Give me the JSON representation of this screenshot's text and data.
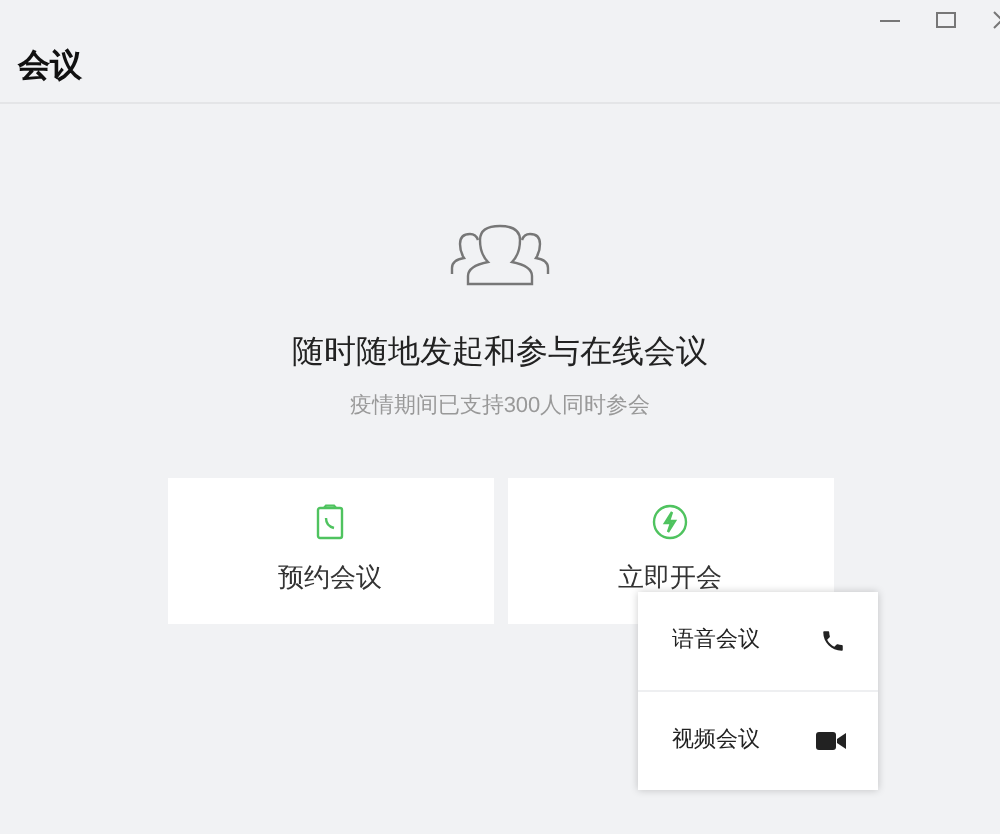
{
  "window": {
    "title": "会议"
  },
  "hero": {
    "heading": "随时随地发起和参与在线会议",
    "subtitle": "疫情期间已支持300人同时参会"
  },
  "actions": [
    {
      "kind": "schedule",
      "label": "预约会议"
    },
    {
      "kind": "instant",
      "label": "立即开会"
    }
  ],
  "menu": {
    "items": [
      {
        "kind": "voice",
        "label": "语音会议"
      },
      {
        "kind": "video",
        "label": "视频会议"
      }
    ]
  }
}
